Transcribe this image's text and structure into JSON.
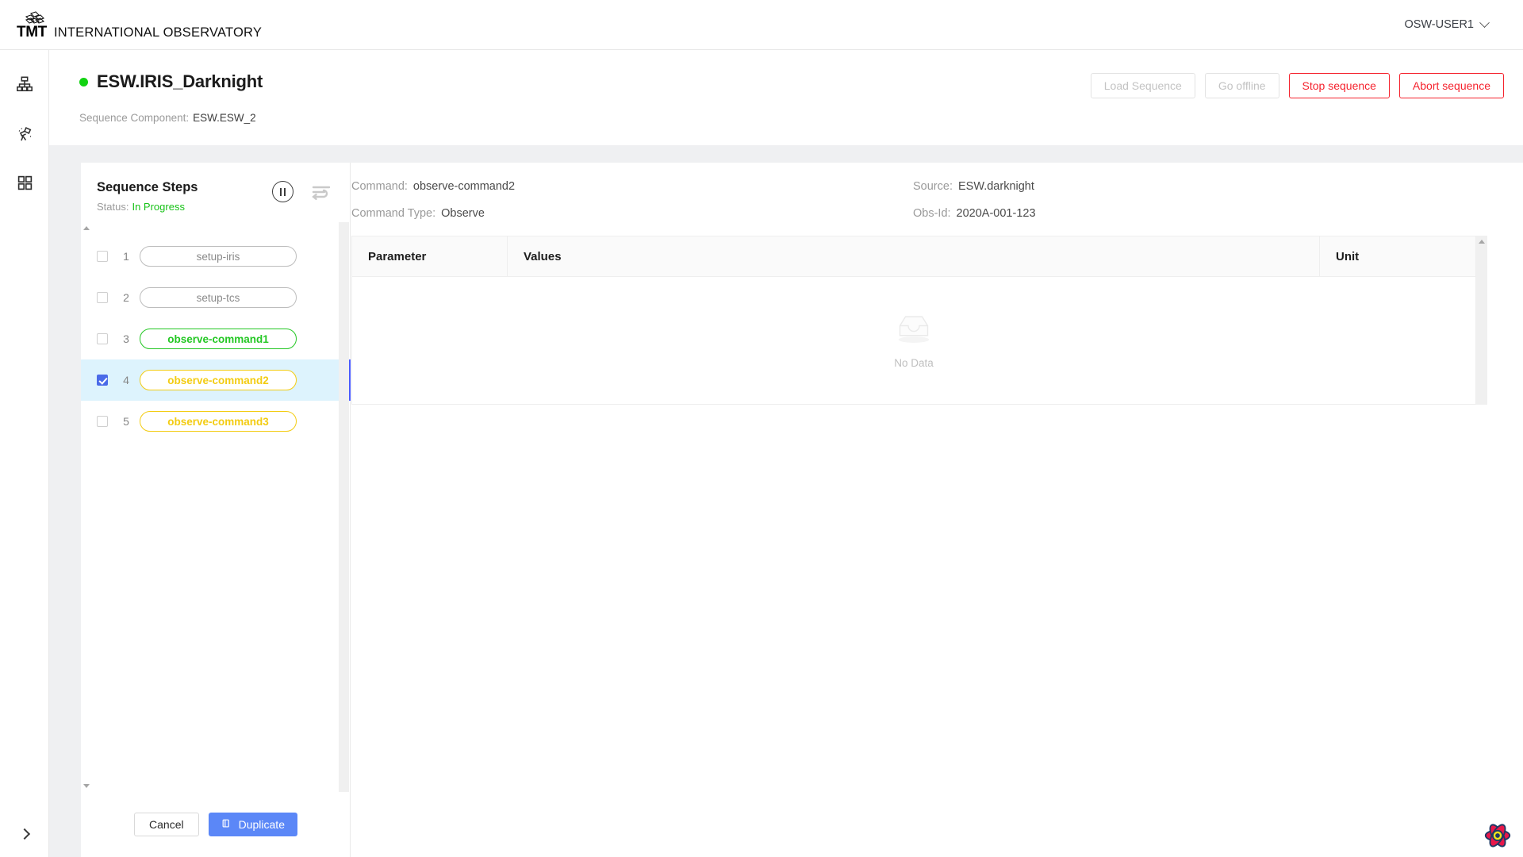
{
  "topbar": {
    "brand_tmt": "TMT",
    "brand_name": "INTERNATIONAL OBSERVATORY",
    "user": "OSW-USER1",
    "caret_icon": "chevron-down-icon"
  },
  "rail": {
    "items": [
      {
        "icon": "sitemap-icon",
        "name": "resources"
      },
      {
        "icon": "telescope-icon",
        "name": "observe"
      },
      {
        "icon": "grid-icon",
        "name": "manage"
      }
    ],
    "expand_icon": "chevron-right-icon"
  },
  "header": {
    "sequence_title": "ESW.IRIS_Darknight",
    "status_dot_color": "#12d312",
    "component_label": "Sequence Component:",
    "component_value": "ESW.ESW_2",
    "actions": [
      {
        "label": "Load Sequence",
        "style": "disabled"
      },
      {
        "label": "Go offline",
        "style": "disabled"
      },
      {
        "label": "Stop sequence",
        "style": "danger"
      },
      {
        "label": "Abort sequence",
        "style": "danger"
      }
    ]
  },
  "steps": {
    "title": "Sequence Steps",
    "status_label": "Status:",
    "status_value": "In Progress",
    "status_color": "#17c217",
    "pause_icon": "pause-icon",
    "flow_icon": "sort-flow-icon",
    "rows": [
      {
        "num": "1",
        "label": "setup-iris",
        "state": "pending",
        "checked": false,
        "selected": false
      },
      {
        "num": "2",
        "label": "setup-tcs",
        "state": "pending",
        "checked": false,
        "selected": false
      },
      {
        "num": "3",
        "label": "observe-command1",
        "state": "success",
        "checked": false,
        "selected": false
      },
      {
        "num": "4",
        "label": "observe-command2",
        "state": "in-progress",
        "checked": true,
        "selected": true
      },
      {
        "num": "5",
        "label": "observe-command3",
        "state": "in-progress",
        "checked": false,
        "selected": false
      }
    ],
    "footer": {
      "cancel_label": "Cancel",
      "duplicate_label": "Duplicate",
      "duplicate_icon": "copy-icon",
      "duplicate_color": "#5b87f7"
    }
  },
  "detail": {
    "command_label": "Command:",
    "command_value": "observe-command2",
    "command_type_label": "Command Type:",
    "command_type_value": "Observe",
    "source_label": "Source:",
    "source_value": "ESW.darknight",
    "obsid_label": "Obs-Id:",
    "obsid_value": "2020A-001-123",
    "table": {
      "columns": [
        "Parameter",
        "Values",
        "Unit"
      ],
      "rows": [],
      "empty_text": "No Data",
      "empty_icon": "empty-box-icon"
    }
  },
  "react_badge": {
    "icon": "react-devtools-flower-icon"
  }
}
